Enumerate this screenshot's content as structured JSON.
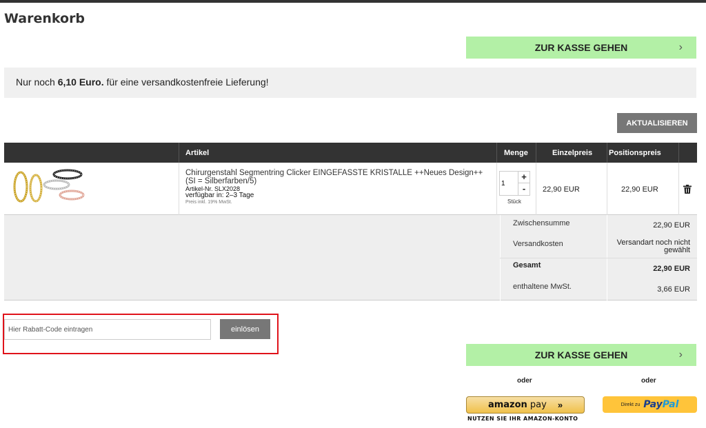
{
  "page": {
    "title": "Warenkorb"
  },
  "checkout": {
    "label": "ZUR KASSE GEHEN",
    "chevron": "›"
  },
  "shipping_notice": {
    "prefix": "Nur noch ",
    "amount": "6,10 Euro.",
    "suffix": " für eine versandkostenfreie Lieferung!"
  },
  "update_button": "AKTUALISIEREN",
  "table": {
    "headers": {
      "article": "Artikel",
      "quantity": "Menge",
      "unit_price": "Einzelpreis",
      "total_price": "Positionspreis"
    },
    "item": {
      "title": "Chirurgenstahl Segmentring Clicker EINGEFASSTE KRISTALLE ++Neues Design++ (SI = Silberfarben/5)",
      "sku": "Artikel-Nr. SLX2028",
      "availability": "verfügbar in: 2–3 Tage",
      "tax_note": "Preis inkl. 19% MwSt.",
      "quantity": "1",
      "plus": "+",
      "minus": "-",
      "unit": "Stück",
      "unit_price": "22,90 EUR",
      "line_price": "22,90 EUR",
      "delete_icon": "trash-icon",
      "thumbnail_icon": "product-rings-image"
    },
    "totals": {
      "subtotal_label": "Zwischensumme",
      "subtotal_value": "22,90 EUR",
      "shipping_label": "Versandkosten",
      "shipping_value": "Versandart noch nicht gewählt",
      "total_label": "Gesamt",
      "total_value": "22,90 EUR",
      "vat_label": "enthaltene MwSt.",
      "vat_value": "3,66 EUR"
    }
  },
  "coupon": {
    "placeholder": "Hier Rabatt-Code eintragen",
    "button": "einlösen"
  },
  "alternatives": {
    "or": "oder",
    "amazon_pay": {
      "brand_a": "amazon",
      "brand_b": " pay",
      "arrows": "»",
      "caption": "NUTZEN SIE IHR AMAZON-KONTO"
    },
    "paypal": {
      "prefix": "Direkt zu",
      "pay": "Pay",
      "pal": "Pal"
    }
  },
  "colors": {
    "checkout_green": "#b3f0a6",
    "header_dark": "#333333",
    "button_gray": "#777777",
    "highlight_red": "#e0121a",
    "paypal_yellow": "#ffc43a"
  }
}
